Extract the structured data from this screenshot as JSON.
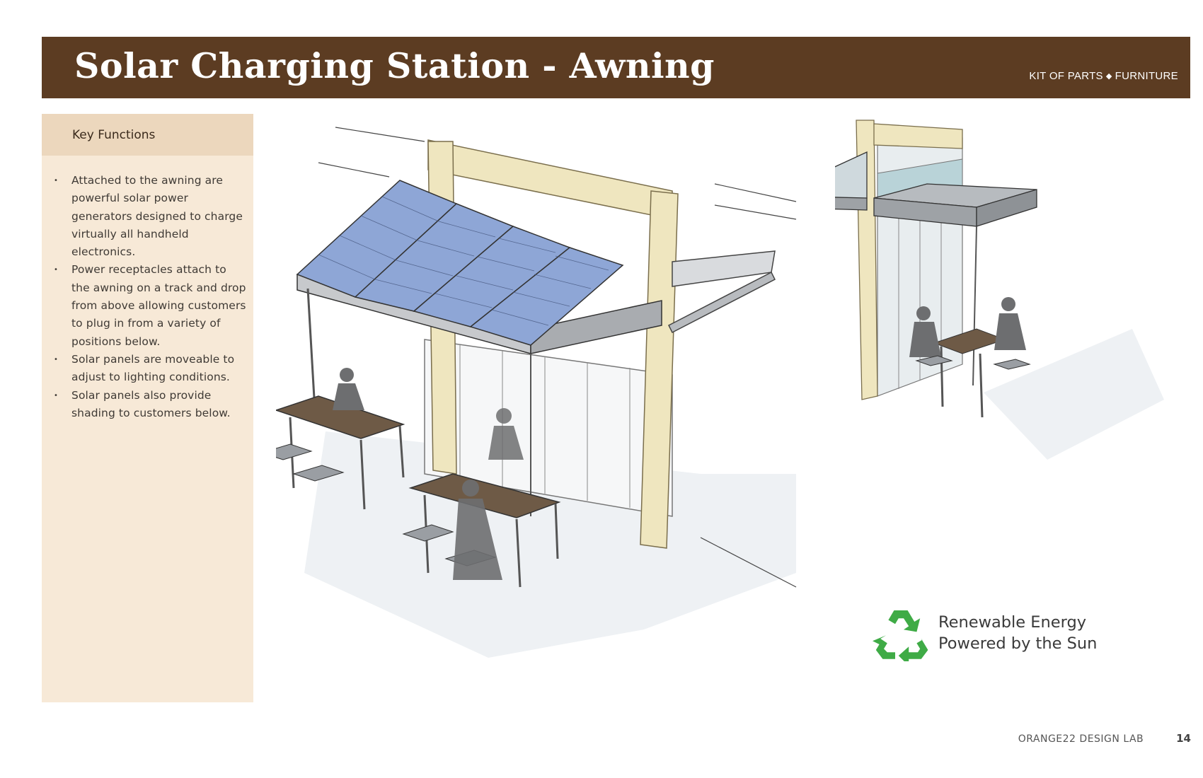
{
  "header": {
    "title": "Solar Charging Station - Awning",
    "section": "KIT OF PARTS",
    "section_separator": "◆",
    "category": "FURNITURE",
    "bar_color": "#5c3c22"
  },
  "sidebar": {
    "heading": "Key Functions",
    "bullet": "•",
    "items": [
      "Attached to the awning are powerful solar power generators designed to charge virtually all handheld electronics.",
      "Power receptacles attach to the awning on a track and drop from above allowing customers to plug in from a variety of positions below.",
      "Solar panels are moveable to adjust to lighting conditions.",
      "Solar panels also provide shading to customers below."
    ],
    "background_color": "#f7e9d7",
    "heading_background_color": "#ecd7bd"
  },
  "badge": {
    "icon": "recycle-icon",
    "line1": "Renewable Energy",
    "line2": "Powered by the Sun",
    "icon_color": "#3fab46"
  },
  "footer": {
    "org": "ORANGE22 DESIGN LAB",
    "page_number": "14"
  },
  "illustrations": {
    "main": "solar-awning-perspective-sketch",
    "side": "solar-awning-elevation-sketch"
  }
}
